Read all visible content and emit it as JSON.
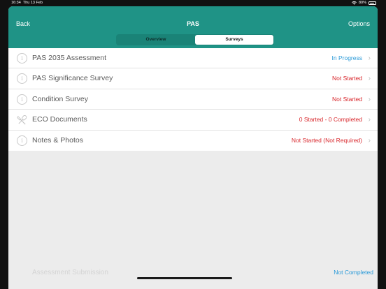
{
  "status_bar": {
    "time": "16:34",
    "date": "Thu 13 Feb",
    "battery": "80%",
    "battery_level": 0.8
  },
  "navbar": {
    "back_label": "Back",
    "title": "PAS",
    "options_label": "Options"
  },
  "segments": [
    {
      "label": "Overview",
      "active": false
    },
    {
      "label": "Surveys",
      "active": true
    }
  ],
  "colors": {
    "nav_teal": "#1f9386",
    "status_blue": "#2a9ad8",
    "status_red": "#d8262b"
  },
  "rows": [
    {
      "label": "PAS 2035 Assessment",
      "status": "In Progress",
      "status_color": "#2a9ad8",
      "icon": "info-icon"
    },
    {
      "label": "PAS Significance Survey",
      "status": "Not Started",
      "status_color": "#d8262b",
      "icon": "info-icon"
    },
    {
      "label": "Condition Survey",
      "status": "Not Started",
      "status_color": "#d8262b",
      "icon": "info-icon"
    },
    {
      "label": "ECO Documents",
      "status": "0 Started - 0 Completed",
      "status_color": "#d8262b",
      "icon": "tools-icon"
    },
    {
      "label": "Notes & Photos",
      "status": "Not Started (Not Required)",
      "status_color": "#d8262b",
      "icon": "info-icon"
    }
  ],
  "footer": {
    "label": "Assessment Submission",
    "status": "Not Completed",
    "status_color": "#2a9ad8"
  }
}
